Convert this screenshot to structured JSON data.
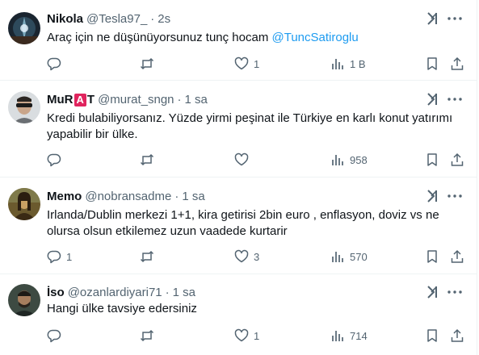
{
  "tweets": [
    {
      "name": "Nikola",
      "handle": "@Tesla97_",
      "separator": "·",
      "time": "2s",
      "text": "Araç için ne düşünüyorsunuz tunç hocam ",
      "mention": "@TuncSatiroglu",
      "replies": "",
      "retweets": "",
      "likes": "1",
      "views": "1 B"
    },
    {
      "name_prefix": "MuR",
      "name_badge": "A",
      "name_suffix": "T",
      "handle": "@murat_sngn",
      "separator": "·",
      "time": "1 sa",
      "text_line1": "Kredi bulabiliyorsanız. Yüzde yirmi peşinat ile Türkiye en karlı konut yatırımı",
      "text_line2": "yapabilir bir ülke.",
      "replies": "",
      "retweets": "",
      "likes": "",
      "views": "958"
    },
    {
      "name": "Memo",
      "handle": "@nobransadme",
      "separator": "·",
      "time": "1 sa",
      "text_line1": "Irlanda/Dublin merkezi 1+1, kira getirisi 2bin euro , enflasyon, doviz vs ne",
      "text_line2": "olursa olsun etkilemez uzun vaadede kurtarir",
      "replies": "1",
      "retweets": "",
      "likes": "3",
      "views": "570"
    },
    {
      "name": "İso",
      "handle": "@ozanlardiyari71",
      "separator": "·",
      "time": "1 sa",
      "text": "Hangi ülke tavsiye edersiniz",
      "replies": "",
      "retweets": "",
      "likes": "1",
      "views": "714"
    }
  ],
  "colors": {
    "text": "#0f1419",
    "secondary": "#536471",
    "link": "#1d9bf0",
    "divider": "#eff3f4",
    "badge": "#e0245e"
  },
  "icons": [
    "reply-icon",
    "retweet-icon",
    "like-icon",
    "views-icon",
    "bookmark-icon",
    "share-icon",
    "grok-icon",
    "more-icon"
  ]
}
